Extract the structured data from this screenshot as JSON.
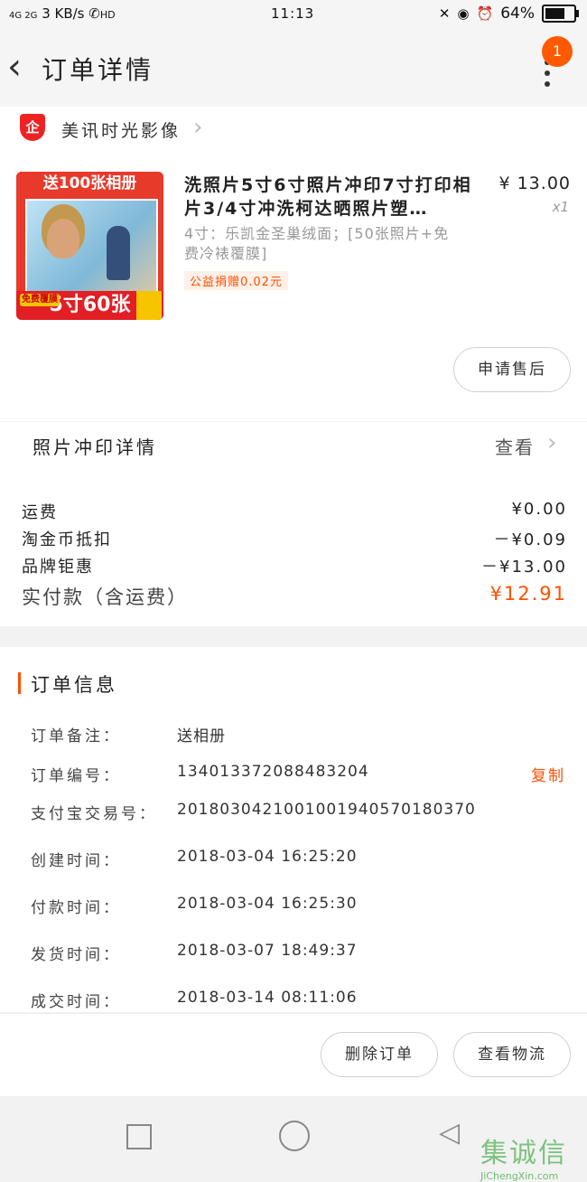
{
  "status_bar": {
    "network": "4G 2G",
    "speed": "3 KB/s",
    "hd": "HD",
    "time": "11:13",
    "battery": "64%"
  },
  "header": {
    "title": "订单详情",
    "badge": "1"
  },
  "shop": {
    "name": "美讯时光影像",
    "logo": "企"
  },
  "product": {
    "image_banner": "送100张相册",
    "image_promo": "5寸60张",
    "image_tag": "免费覆膜",
    "title": "洗照片5寸6寸照片冲印7寸打印相片3/4寸冲洗柯达晒照片塑…",
    "price": "¥ 13.00",
    "qty": "x1",
    "sku": "4寸：乐凯金圣巢绒面；[50张照片+免费冷裱覆膜]",
    "charity": "公益捐赠0.02元",
    "after_sale_label": "申请售后"
  },
  "print_details": {
    "label": "照片冲印详情",
    "view": "查看"
  },
  "fees": [
    {
      "label": "运费",
      "value": "¥0.00"
    },
    {
      "label": "淘金币抵扣",
      "value": "－¥0.09"
    },
    {
      "label": "品牌钜惠",
      "value": "－¥13.00"
    },
    {
      "label": "实付款（含运费）",
      "value": "¥12.91"
    }
  ],
  "order_info": {
    "title": "订单信息",
    "rows": [
      {
        "label": "订单备注：",
        "value": "送相册"
      },
      {
        "label": "订单编号：",
        "value": "134013372088483204"
      },
      {
        "label": "支付宝交易号：",
        "value": "2018030421001001940570180370"
      },
      {
        "label": "创建时间：",
        "value": "2018-03-04 16:25:20"
      },
      {
        "label": "付款时间：",
        "value": "2018-03-04 16:25:30"
      },
      {
        "label": "发货时间：",
        "value": "2018-03-07 18:49:37"
      },
      {
        "label": "成交时间：",
        "value": "2018-03-14 08:11:06"
      }
    ],
    "copy_label": "复制"
  },
  "actions": {
    "delete_label": "删除订单",
    "logistics_label": "查看物流"
  },
  "watermark": {
    "cn": "集诚信",
    "en": "JiChengXin.com"
  },
  "colors": {
    "accent": "#ff5000",
    "badge": "#ff5a00"
  }
}
